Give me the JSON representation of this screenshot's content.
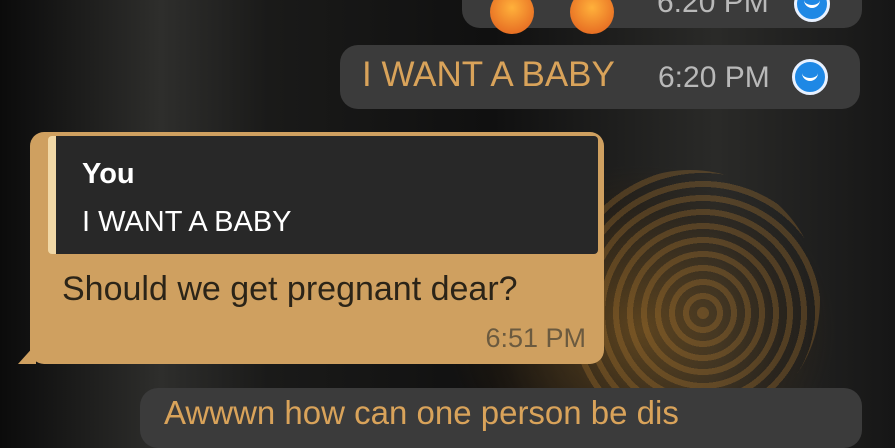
{
  "messages": [
    {
      "direction": "outgoing",
      "content": "emoji",
      "time": "6:20 PM",
      "status": "read-smiley-icon"
    },
    {
      "direction": "outgoing",
      "text": "I WANT A BABY",
      "time": "6:20 PM",
      "status": "read-smiley-icon"
    },
    {
      "direction": "incoming",
      "quote": {
        "author": "You",
        "text": "I WANT A BABY"
      },
      "text": "Should we get pregnant dear?",
      "time": "6:51 PM"
    },
    {
      "direction": "outgoing",
      "text": "Awwwn how can one person be dis"
    }
  ],
  "colors": {
    "outgoing_bubble": "#3b3b3b",
    "outgoing_text": "#d9a35a",
    "incoming_bubble": "#cfa060",
    "quote_background": "#282828",
    "read_icon": "#1e88e5"
  }
}
